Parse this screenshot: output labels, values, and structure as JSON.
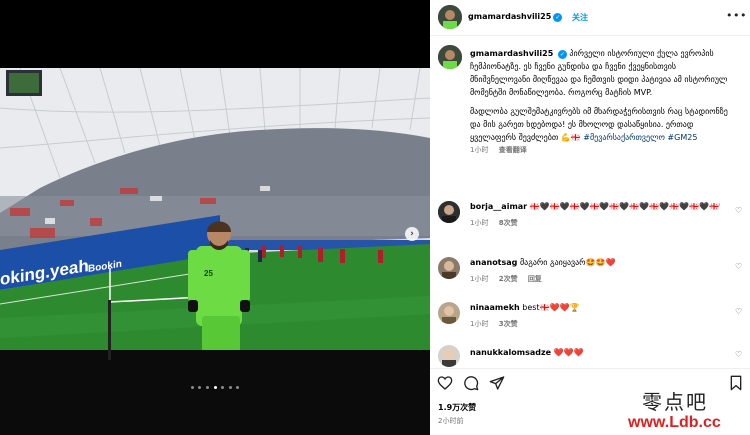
{
  "post": {
    "username": "gmamardashvili25",
    "follow_label": "关注",
    "more_label": "•••",
    "caption": {
      "username": "gmamardashvili25",
      "text_p1": "პირველი ისტორიული ქულა ევროპის ჩემპიონატზე. ეს ჩვენი გუნდისა და ჩვენი ქვეყნისთვის მნიშვნელოვანი მიღწევაა და ჩემთვის დიდი პატივია ამ ისტორიულ მომენტში მონაწილეობა. როგორც მატჩის MVP.",
      "text_p2": "მადლობა გულშემატკივრებს იმ მხარდაჭერისთვის რაც სტადიონზე და მის გარეთ ხდებოდა! ეს მხოლოდ დასაწყისია. ერთად ყველაფერს შევძლებთ 💪🇬🇪",
      "hashtags": "#მევარსაქართველო #GM25",
      "time": "1小时",
      "translate": "查看翻译"
    },
    "comments": [
      {
        "username": "borja__aimar",
        "text": "🇬🇪🖤🇬🇪🖤🇬🇪🖤🇬🇪🖤🇬🇪🖤🇬🇪🖤🇬🇪🖤🇬🇪🖤🇬🇪🖤🇬🇪🖤🇬🇪🖤🇬🇪",
        "time": "1小时",
        "likes": "8次赞"
      },
      {
        "username": "ananotsag",
        "text": "მაგარი გაიყავარ🤩🤩❤️",
        "time": "1小时",
        "likes": "2次赞",
        "reply": "回复"
      },
      {
        "username": "ninaamekh",
        "text": "best🇬🇪❤️❤️🏆",
        "time": "1小时",
        "likes": "3次赞"
      },
      {
        "username": "nanukkalomsadze",
        "text": "❤️❤️❤️",
        "time": "",
        "likes": ""
      }
    ],
    "likes_count": "1.9万次赞",
    "date": "2小时前",
    "carousel_index": 4,
    "carousel_total": 7
  },
  "media": {
    "ad_board_text": "oking.yeah",
    "ad_board_text2": "Bookin",
    "player_number": "25"
  },
  "watermark": {
    "cn": "零点吧",
    "url": "www.Ldb.cc"
  },
  "colors": {
    "accent": "#0095f6",
    "pitch": "#2e8a2e",
    "kit": "#6ddc44",
    "roof": "#e9ebee"
  }
}
